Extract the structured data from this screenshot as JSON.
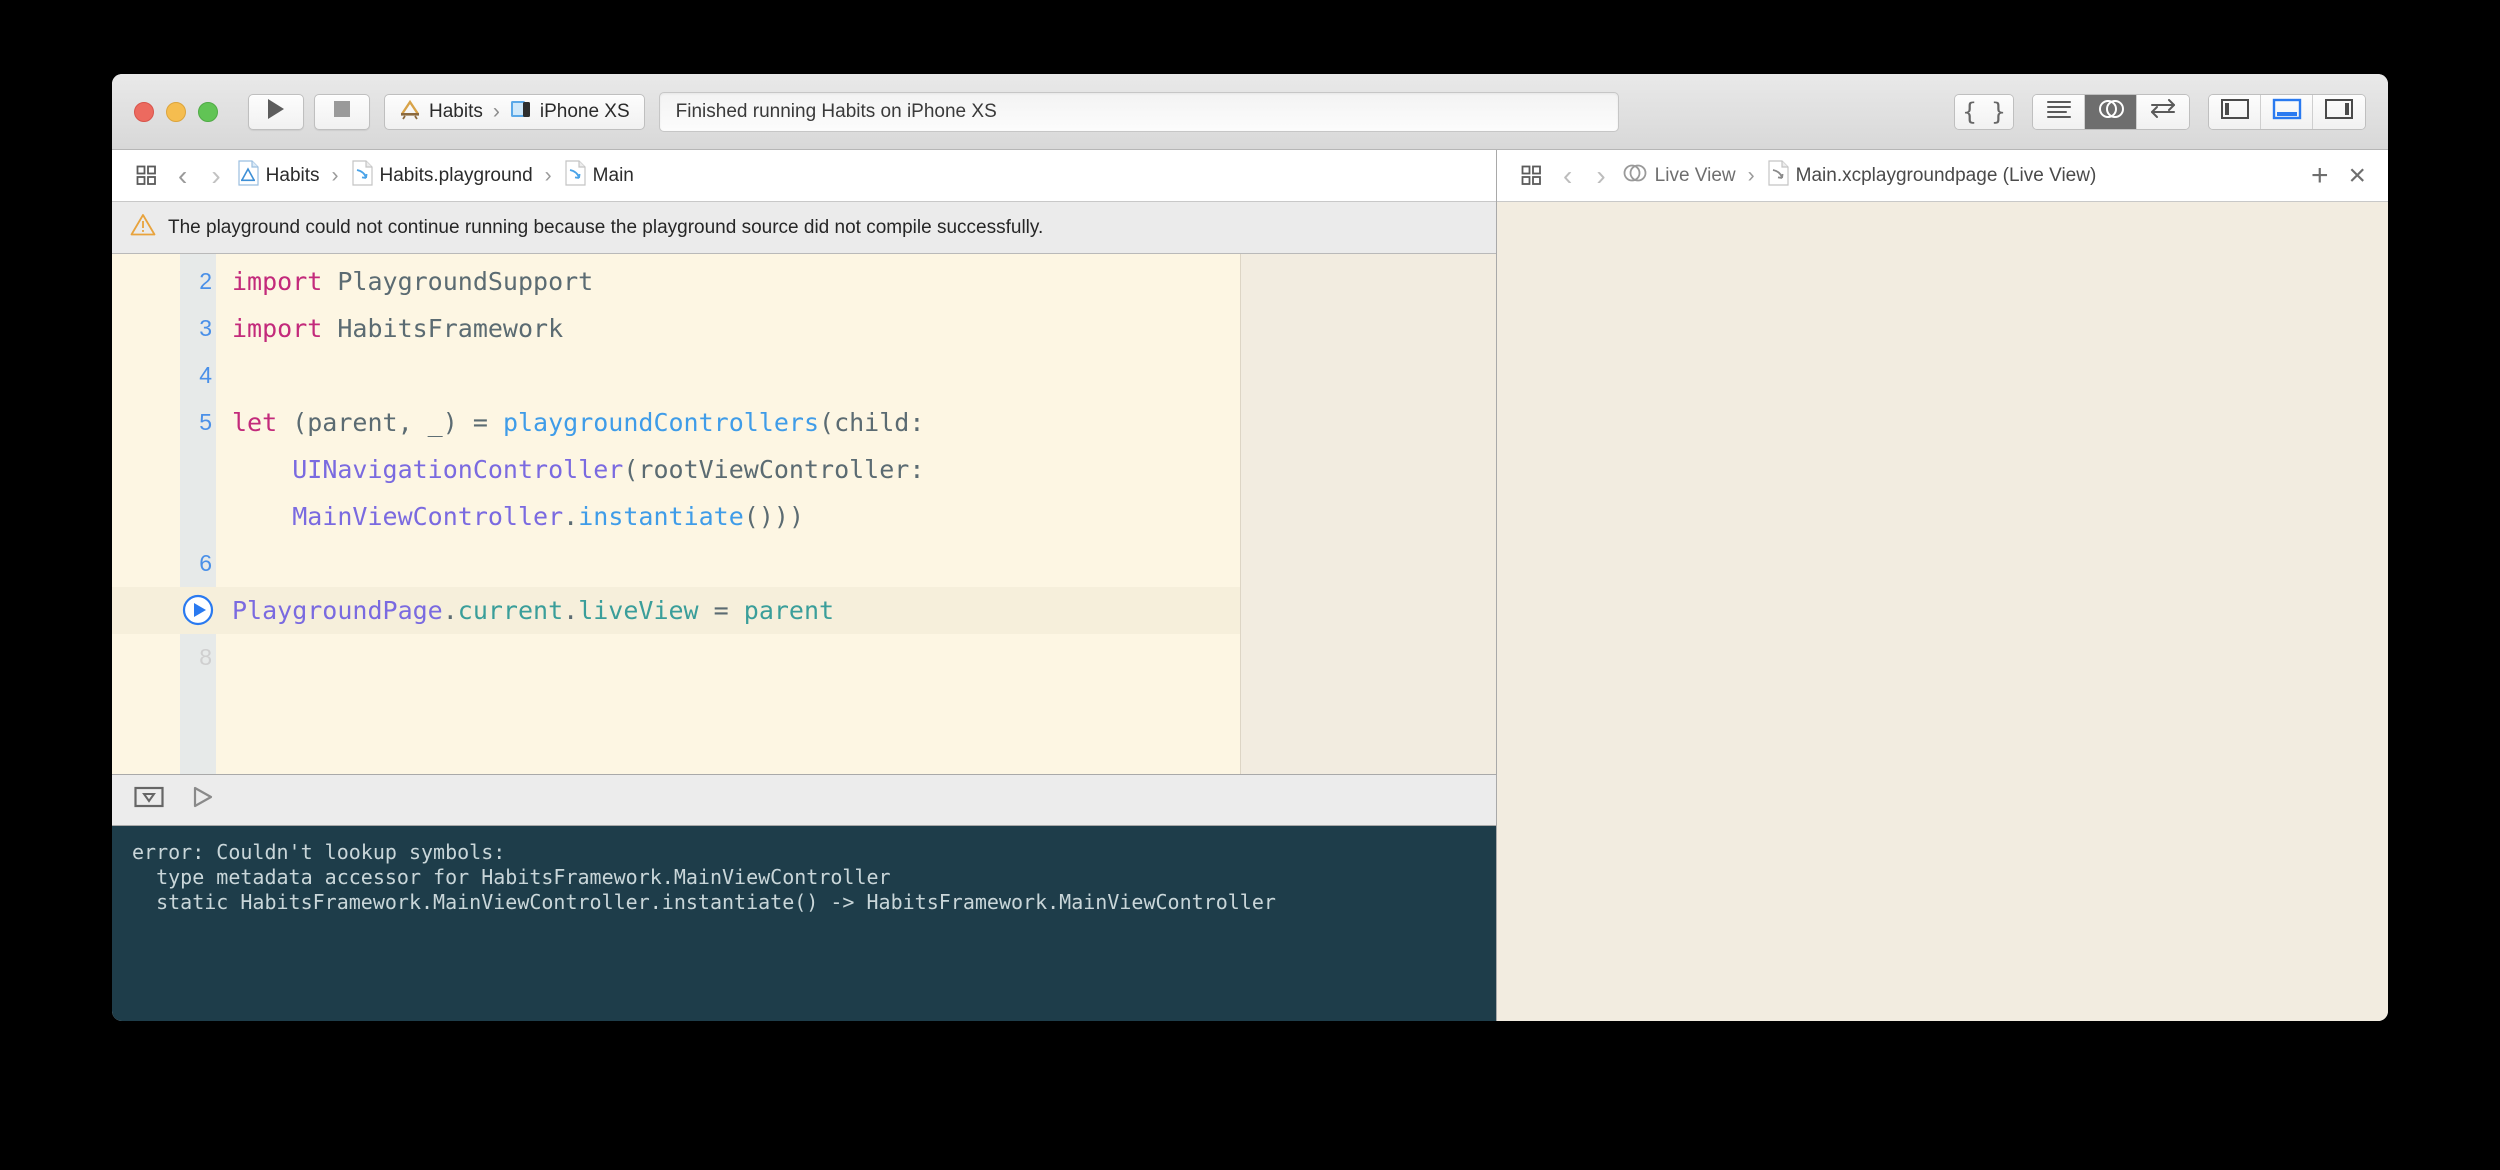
{
  "window": {
    "traffic_lights": [
      {
        "name": "close",
        "color": "#ec6a5f"
      },
      {
        "name": "minimize",
        "color": "#f5bd4f"
      },
      {
        "name": "zoom",
        "color": "#61c455"
      }
    ]
  },
  "toolbar": {
    "run_label": "run-icon",
    "stop_label": "stop-icon",
    "scheme": {
      "project": "Habits",
      "separator": "›",
      "destination": "iPhone XS"
    },
    "status": "Finished running Habits on iPhone XS",
    "buttons": {
      "code_snippets": "{ }",
      "standard_editor": "standard-editor-icon",
      "assistant_editor": "assistant-editor-icon",
      "version_editor": "version-editor-icon",
      "navigator_toggle": "navigator-toggle-icon",
      "debug_toggle": "debug-area-toggle-icon",
      "utilities_toggle": "utilities-toggle-icon"
    }
  },
  "editor_jumpbar": {
    "related_items": "related-items-icon",
    "back": "‹",
    "forward": "›",
    "crumbs": [
      {
        "icon": "xcode-project-icon",
        "label": "Habits"
      },
      {
        "icon": "playground-file-icon",
        "label": "Habits.playground"
      },
      {
        "icon": "playground-page-icon",
        "label": "Main"
      }
    ],
    "separator": "›"
  },
  "liveview_jumpbar": {
    "related_items": "related-items-icon",
    "back": "‹",
    "forward": "›",
    "crumbs": [
      {
        "icon": "assistant-editor-icon",
        "label": "Live View"
      },
      {
        "icon": "playground-page-icon",
        "label": "Main.xcplaygroundpage (Live View)"
      }
    ],
    "separator": "›",
    "add_label": "+",
    "close_label": "×"
  },
  "warning": {
    "icon": "warning-triangle-icon",
    "message": "The playground could not continue running because the playground source did not compile successfully.",
    "color": "#e8a33d"
  },
  "code": {
    "lines": [
      {
        "number": "2",
        "dim": false,
        "highlight": false,
        "run_button": false,
        "tokens": [
          {
            "t": "import",
            "c": "kw"
          },
          {
            "t": " PlaygroundSupport",
            "c": "pln"
          }
        ]
      },
      {
        "number": "3",
        "dim": false,
        "highlight": false,
        "run_button": false,
        "tokens": [
          {
            "t": "import",
            "c": "kw"
          },
          {
            "t": " HabitsFramework",
            "c": "pln"
          }
        ]
      },
      {
        "number": "4",
        "dim": false,
        "highlight": false,
        "run_button": false,
        "tokens": []
      },
      {
        "number": "5",
        "dim": false,
        "highlight": false,
        "run_button": false,
        "tokens": [
          {
            "t": "let",
            "c": "kw"
          },
          {
            "t": " (parent, _) = ",
            "c": "pln"
          },
          {
            "t": "playgroundControllers",
            "c": "fn"
          },
          {
            "t": "(child:",
            "c": "pln"
          }
        ]
      },
      {
        "number": "",
        "dim": false,
        "highlight": false,
        "run_button": false,
        "tokens": [
          {
            "t": "    ",
            "c": "pln"
          },
          {
            "t": "UINavigationController",
            "c": "typ"
          },
          {
            "t": "(rootViewController:",
            "c": "pln"
          }
        ]
      },
      {
        "number": "",
        "dim": false,
        "highlight": false,
        "run_button": false,
        "tokens": [
          {
            "t": "    ",
            "c": "pln"
          },
          {
            "t": "MainViewController",
            "c": "typ"
          },
          {
            "t": ".",
            "c": "pln"
          },
          {
            "t": "instantiate",
            "c": "fn"
          },
          {
            "t": "()))",
            "c": "pln"
          }
        ]
      },
      {
        "number": "6",
        "dim": false,
        "highlight": false,
        "run_button": false,
        "tokens": []
      },
      {
        "number": "",
        "dim": false,
        "highlight": true,
        "run_button": true,
        "tokens": [
          {
            "t": "PlaygroundPage",
            "c": "typ"
          },
          {
            "t": ".",
            "c": "pln"
          },
          {
            "t": "current",
            "c": "prop"
          },
          {
            "t": ".",
            "c": "pln"
          },
          {
            "t": "liveView",
            "c": "prop"
          },
          {
            "t": " = ",
            "c": "pln"
          },
          {
            "t": "parent",
            "c": "prop"
          }
        ]
      },
      {
        "number": "8",
        "dim": true,
        "highlight": false,
        "run_button": false,
        "tokens": []
      }
    ]
  },
  "debug_bar": {
    "hide_console": "hide-console-icon",
    "continue": "continue-execution-icon"
  },
  "console": {
    "text": "error: Couldn't lookup symbols:\n  type metadata accessor for HabitsFramework.MainViewController\n  static HabitsFramework.MainViewController.instantiate() -> HabitsFramework.MainViewController"
  },
  "colors": {
    "code_background": "#fdf6e3",
    "results_sidebar": "#f2ece0",
    "console_background": "#1e3d4a",
    "accent_blue": "#4a90e8",
    "keyword_pink": "#c32a7b",
    "type_purple": "#7a6ae0",
    "function_blue": "#3f9ce8",
    "property_teal": "#3a9e9a"
  }
}
